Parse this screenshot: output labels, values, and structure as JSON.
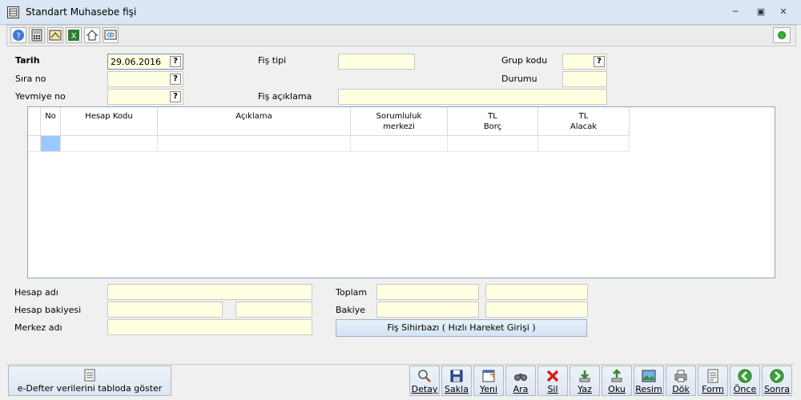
{
  "window": {
    "title": "Standart Muhasebe fişi",
    "status_color": "#2fb52f"
  },
  "toolbar": {
    "icons": [
      "help-icon",
      "calculator-icon",
      "settings-icon",
      "excel-icon",
      "home-icon",
      "view-icon"
    ]
  },
  "form": {
    "tarih": {
      "label": "Tarih",
      "value": "29.06.2016",
      "lookup": "?"
    },
    "sira_no": {
      "label": "Sıra no",
      "value": "",
      "lookup": "?"
    },
    "yevmiye_no": {
      "label": "Yevmiye no",
      "value": "",
      "lookup": "?"
    },
    "fis_tipi": {
      "label": "Fiş tipi",
      "value": ""
    },
    "fis_aciklama": {
      "label": "Fiş açıklama",
      "value": ""
    },
    "grup_kodu": {
      "label": "Grup kodu",
      "value": "",
      "lookup": "?"
    },
    "durumu": {
      "label": "Durumu",
      "value": ""
    }
  },
  "grid": {
    "columns": [
      "No",
      "Hesap Kodu",
      "Açıklama",
      "Sorumluluk\nmerkezi",
      "TL\nBorç",
      "TL\nAlacak"
    ]
  },
  "footer": {
    "hesap_adi": {
      "label": "Hesap adı",
      "value": ""
    },
    "hesap_bakiyesi": {
      "label": "Hesap bakiyesi",
      "value": "",
      "value2": ""
    },
    "merkez_adi": {
      "label": "Merkez adı",
      "value": ""
    },
    "toplam": {
      "label": "Toplam",
      "borc": "",
      "alacak": ""
    },
    "bakiye": {
      "label": "Bakiye",
      "borc": "",
      "alacak": ""
    },
    "wizard_label": "Fiş Sihirbazı ( Hızlı Hareket Girişi )"
  },
  "bottom": {
    "edefter_label": "e-Defter verilerini tabloda göster",
    "actions": [
      {
        "label": "Detay",
        "icon": "magnifier-icon"
      },
      {
        "label": "Sakla",
        "icon": "save-icon"
      },
      {
        "label": "Yeni",
        "icon": "new-document-icon"
      },
      {
        "label": "Ara",
        "icon": "binoculars-icon"
      },
      {
        "label": "Sil",
        "icon": "delete-icon"
      },
      {
        "label": "Yaz",
        "icon": "write-icon"
      },
      {
        "label": "Oku",
        "icon": "read-icon"
      },
      {
        "label": "Resim",
        "icon": "picture-icon"
      },
      {
        "label": "Dök",
        "icon": "print-icon"
      },
      {
        "label": "Form",
        "icon": "form-icon"
      },
      {
        "label": "Önce",
        "icon": "previous-icon"
      },
      {
        "label": "Sonra",
        "icon": "next-icon"
      }
    ]
  }
}
